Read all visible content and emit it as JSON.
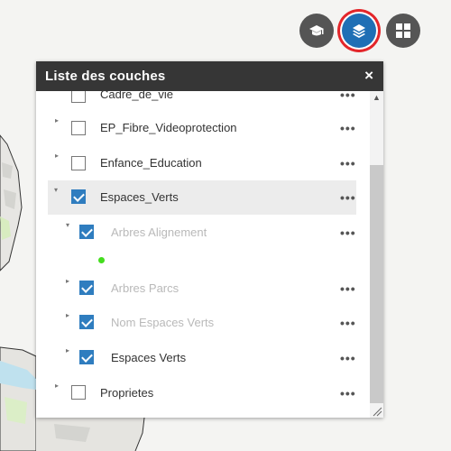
{
  "toolbar": {
    "basemap_icon": "mortarboard-icon",
    "layers_icon": "layers-icon",
    "widgets_icon": "grid-icon",
    "active_highlight_color": "#e3262a",
    "active_button_color": "#1f6fb5"
  },
  "panel": {
    "title": "Liste des couches",
    "close_label": "×",
    "items": [
      {
        "label": "Cadre_de_vie",
        "checked": false,
        "level": 0,
        "expanded": false
      },
      {
        "label": "EP_Fibre_Videoprotection",
        "checked": false,
        "level": 0,
        "expanded": false
      },
      {
        "label": "Enfance_Education",
        "checked": false,
        "level": 0,
        "expanded": false
      },
      {
        "label": "Espaces_Verts",
        "checked": true,
        "level": 0,
        "expanded": true
      },
      {
        "label": "Arbres Alignement",
        "checked": true,
        "level": 1,
        "expanded": true,
        "dimmed": true
      },
      {
        "label": "Arbres Parcs",
        "checked": true,
        "level": 1,
        "expanded": false,
        "dimmed": true
      },
      {
        "label": "Nom Espaces Verts",
        "checked": true,
        "level": 1,
        "expanded": false,
        "dimmed": true
      },
      {
        "label": "Espaces Verts",
        "checked": true,
        "level": 1,
        "expanded": false
      },
      {
        "label": "Proprietes",
        "checked": false,
        "level": 0,
        "expanded": false
      }
    ],
    "more_label": "•••",
    "legend_color": "#44dd1e"
  }
}
